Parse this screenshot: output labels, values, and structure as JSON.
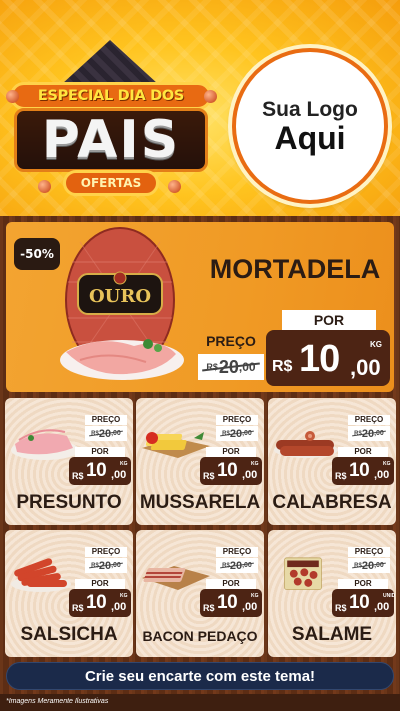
{
  "header": {
    "promo_title": "ESPECIAL DIA DOS",
    "promo_big": "PAIS",
    "promo_tag": "OFERTAS",
    "logo_line1": "Sua Logo",
    "logo_line2": "Aqui"
  },
  "hero": {
    "discount": "-50%",
    "name": "MORTADELA",
    "brand_label": "OURO",
    "prev_label": "PREÇO",
    "prev_currency": "R$",
    "prev_int": "20",
    "prev_dec": ",00",
    "por_label": "POR",
    "currency": "R$",
    "price_int": "10",
    "price_dec": ",00",
    "unit": "KG"
  },
  "products": [
    {
      "name": "PRESUNTO",
      "prev_label": "PREÇO",
      "prev_currency": "R$",
      "prev_int": "20",
      "prev_dec": ",00",
      "por_label": "POR",
      "currency": "R$",
      "price_int": "10",
      "price_dec": ",00",
      "unit": "KG",
      "icon": "ham-slices-icon"
    },
    {
      "name": "MUSSARELA",
      "prev_label": "PREÇO",
      "prev_currency": "R$",
      "prev_int": "20",
      "prev_dec": ",00",
      "por_label": "POR",
      "currency": "R$",
      "price_int": "10",
      "price_dec": ",00",
      "unit": "KG",
      "icon": "cheese-icon"
    },
    {
      "name": "CALABRESA",
      "prev_label": "PREÇO",
      "prev_currency": "R$",
      "prev_int": "20",
      "prev_dec": ",00",
      "por_label": "POR",
      "currency": "R$",
      "price_int": "10",
      "price_dec": ",00",
      "unit": "KG",
      "icon": "sausage-icon"
    },
    {
      "name": "SALSICHA",
      "prev_label": "PREÇO",
      "prev_currency": "R$",
      "prev_int": "20",
      "prev_dec": ",00",
      "por_label": "POR",
      "currency": "R$",
      "price_int": "10",
      "price_dec": ",00",
      "unit": "KG",
      "icon": "hot-dogs-icon"
    },
    {
      "name": "BACON PEDAÇO",
      "prev_label": "PREÇO",
      "prev_currency": "R$",
      "prev_int": "20",
      "prev_dec": ",00",
      "por_label": "POR",
      "currency": "R$",
      "price_int": "10",
      "price_dec": ",00",
      "unit": "KG",
      "icon": "bacon-icon"
    },
    {
      "name": "SALAME",
      "prev_label": "PREÇO",
      "prev_currency": "R$",
      "prev_int": "20",
      "prev_dec": ",00",
      "por_label": "POR",
      "currency": "R$",
      "price_int": "10",
      "price_dec": ",00",
      "unit": "UNID",
      "icon": "salami-pack-icon"
    }
  ],
  "cta": "Crie seu encarte com este tema!",
  "disclaimer": "*Imagens Meramente Ilustrativas",
  "colors": {
    "accent": "#4d2414",
    "cta": "#1b2a4a",
    "hero": "#f3a431"
  }
}
